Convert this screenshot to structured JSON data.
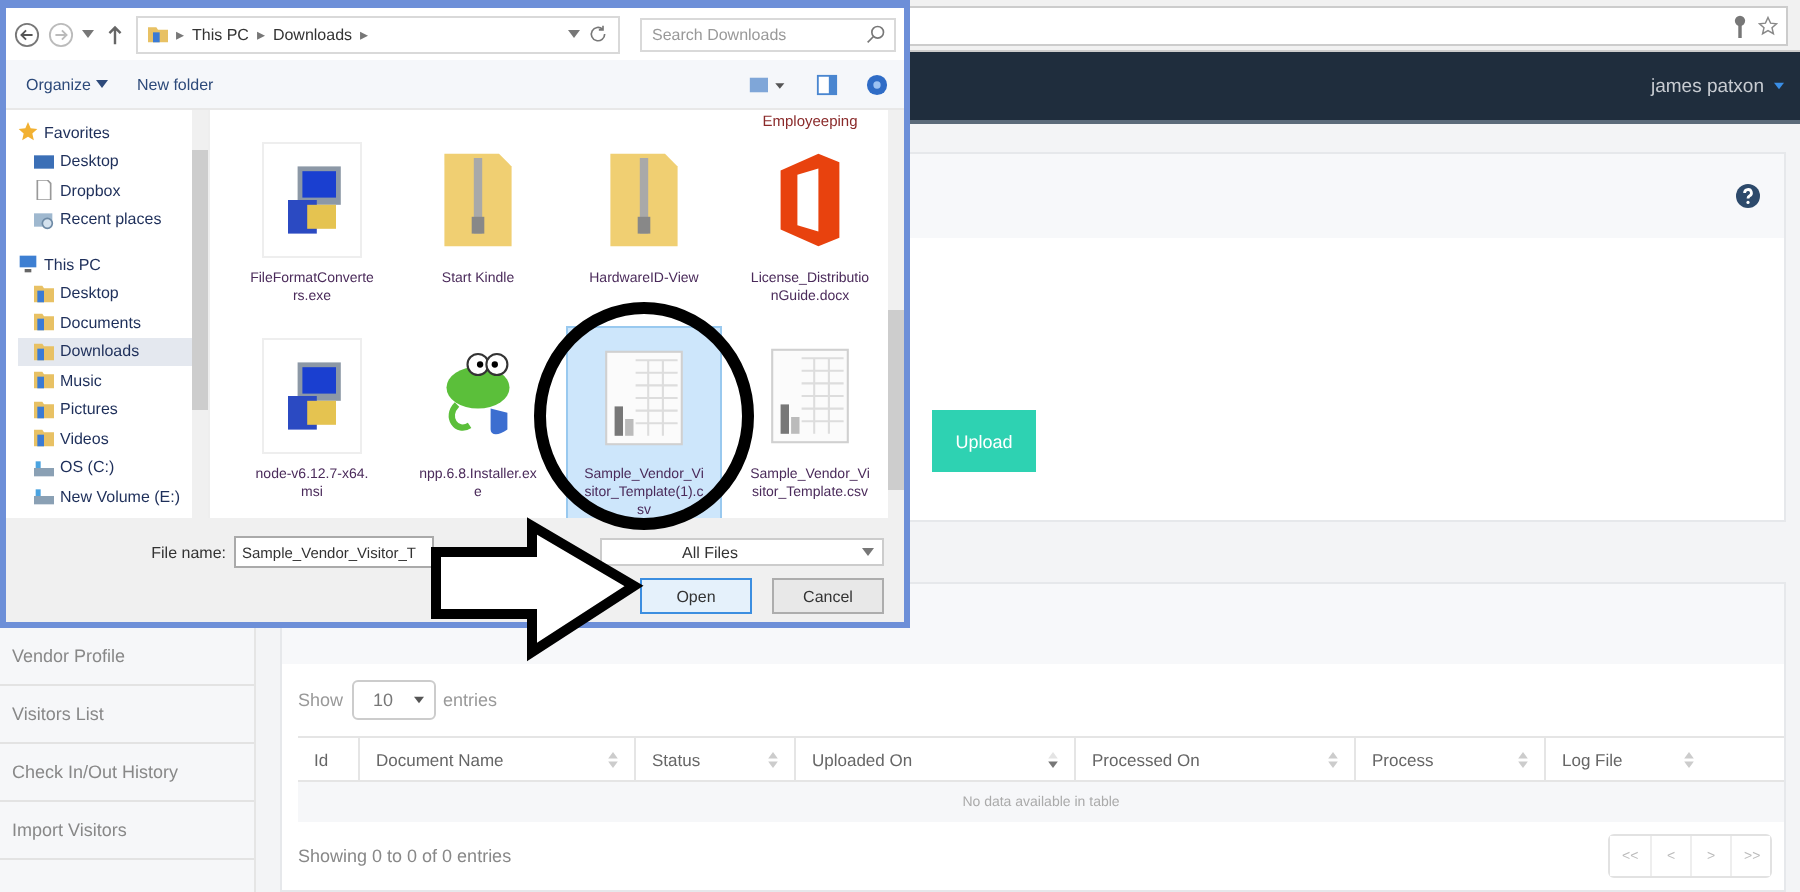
{
  "navbar": {
    "user": "james patxon"
  },
  "upload_card": {
    "button": "Upload"
  },
  "sidebar": {
    "items": [
      {
        "label": "Vendor Profile",
        "selected": false
      },
      {
        "label": "Visitors List",
        "selected": false
      },
      {
        "label": "Check In/Out History",
        "selected": false
      },
      {
        "label": "Import Visitors",
        "selected": false
      }
    ]
  },
  "table": {
    "show_label": "Show",
    "page_length": "10",
    "entries_label": "entries",
    "columns": [
      {
        "label": "Id",
        "sorted": false
      },
      {
        "label": "Document Name",
        "sorted": false
      },
      {
        "label": "Status",
        "sorted": false
      },
      {
        "label": "Uploaded On",
        "sorted": true
      },
      {
        "label": "Processed On",
        "sorted": false
      },
      {
        "label": "Process",
        "sorted": false
      },
      {
        "label": "Log File",
        "sorted": false
      }
    ],
    "empty_message": "No data available in table",
    "info": "Showing 0 to 0 of 0 entries",
    "pagination": [
      {
        "label": "<<",
        "disabled": true
      },
      {
        "label": "<",
        "disabled": true
      },
      {
        "label": ">",
        "disabled": true
      },
      {
        "label": ">>",
        "disabled": true
      }
    ]
  },
  "dialog": {
    "path": [
      "▸",
      "This PC",
      "▸",
      "Downloads",
      "▸"
    ],
    "search_placeholder": "Search Downloads",
    "organize": "Organize",
    "new_folder": "New folder",
    "tree": [
      {
        "label": "Favorites",
        "selected": false,
        "children": [
          {
            "label": "Desktop",
            "selected": false
          },
          {
            "label": "Dropbox",
            "selected": false
          },
          {
            "label": "Recent places",
            "selected": false
          }
        ]
      },
      {
        "label": "This PC",
        "selected": false,
        "children": [
          {
            "label": "Desktop",
            "selected": false
          },
          {
            "label": "Documents",
            "selected": false
          },
          {
            "label": "Downloads",
            "selected": true
          },
          {
            "label": "Music",
            "selected": false
          },
          {
            "label": "Pictures",
            "selected": false
          },
          {
            "label": "Videos",
            "selected": false
          },
          {
            "label": "OS (C:)",
            "selected": false
          },
          {
            "label": "New Volume (E:)",
            "selected": false
          }
        ]
      }
    ],
    "cut_label": "Employeeping",
    "files": [
      {
        "name": "FileFormatConverters.exe",
        "kind": "installer",
        "selected": false
      },
      {
        "name": "Start Kindle",
        "kind": "zip",
        "selected": false
      },
      {
        "name": "HardwareID-View",
        "kind": "zip",
        "selected": false
      },
      {
        "name": "License_DistributionGuide.docx",
        "kind": "document",
        "selected": false
      },
      {
        "name": "node-v6.12.7-x64.msi",
        "kind": "installer",
        "selected": false
      },
      {
        "name": "npp.6.8.Installer.exe",
        "kind": "app",
        "selected": false
      },
      {
        "name": "Sample_Vendor_Visitor_Template(1).csv",
        "kind": "spreadsheet",
        "selected": true
      },
      {
        "name": "Sample_Vendor_Visitor_Template.csv",
        "kind": "spreadsheet",
        "selected": false
      }
    ],
    "file_name_label": "File name:",
    "file_name": "Sample_Vendor_Visitor_T",
    "filter": "All Files",
    "buttons": [
      {
        "label": "Open",
        "default": true
      },
      {
        "label": "Cancel",
        "default": false
      }
    ]
  }
}
